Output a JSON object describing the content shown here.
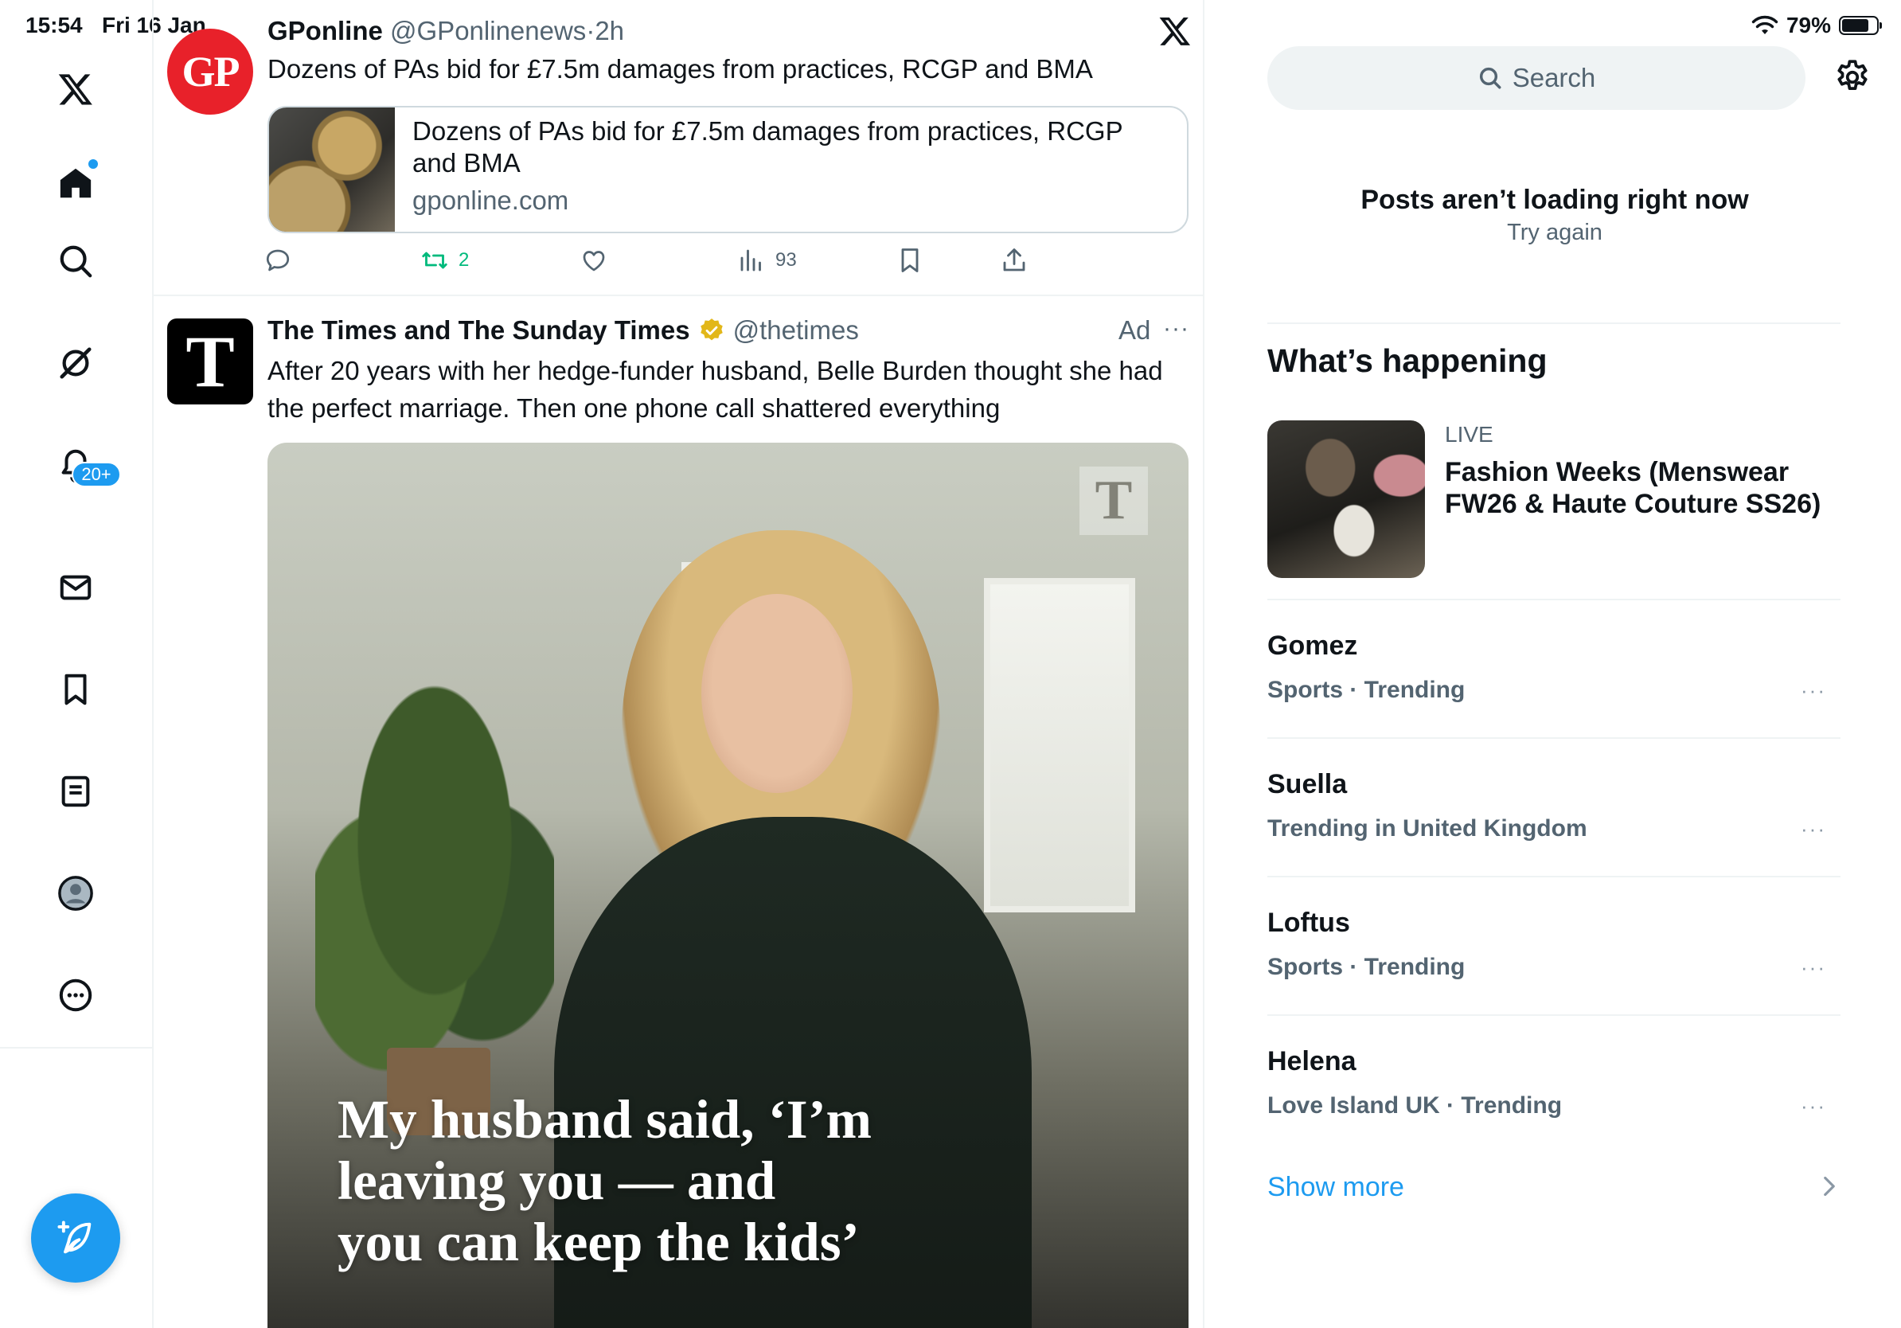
{
  "status_bar": {
    "time": "15:54",
    "date": "Fri 16 Jan",
    "battery": "79%",
    "battery_level": 0.79
  },
  "sidebar": {
    "items": [
      {
        "name": "x-logo"
      },
      {
        "name": "home"
      },
      {
        "name": "explore"
      },
      {
        "name": "grok"
      },
      {
        "name": "notifications",
        "badge": "20+"
      },
      {
        "name": "messages"
      },
      {
        "name": "bookmarks"
      },
      {
        "name": "lists"
      },
      {
        "name": "profile"
      },
      {
        "name": "more"
      }
    ]
  },
  "feed": {
    "tweet1": {
      "avatar_text": "GP",
      "name": "GPonline",
      "handle": "@GPonlinenews",
      "time": "2h",
      "text": "Dozens of PAs bid for £7.5m damages from practices, RCGP and BMA",
      "card": {
        "title": "Dozens of PAs bid for £7.5m damages from practices, RCGP and BMA",
        "domain": "gponline.com"
      },
      "actions": {
        "retweets": "2",
        "views": "93"
      }
    },
    "tweet2": {
      "avatar_text": "T",
      "name": "The Times and The Sunday Times",
      "handle": "@thetimes",
      "ad_label": "Ad",
      "text": "After 20 years with her hedge-funder husband, Belle Burden thought she had the perfect marriage. Then one phone call shattered everything",
      "image_logo": "T",
      "image_headline_lines": [
        "My husband said, ‘I’m",
        "leaving you — and",
        "you can keep the kids’"
      ]
    }
  },
  "right": {
    "search_placeholder": "Search",
    "error": {
      "title": "Posts aren’t loading right now",
      "retry": "Try again"
    },
    "whats_happening": {
      "title": "What’s happening",
      "live": {
        "label": "LIVE",
        "title": "Fashion Weeks (Menswear FW26 & Haute Couture SS26)"
      },
      "trends": [
        {
          "name": "Gomez",
          "meta": "Sports · Trending"
        },
        {
          "name": "Suella",
          "meta": "Trending in United Kingdom"
        },
        {
          "name": "Loftus",
          "meta": "Sports · Trending"
        },
        {
          "name": "Helena",
          "meta": "Love Island UK · Trending"
        }
      ],
      "show_more": "Show more"
    }
  },
  "colors": {
    "accent": "#1d9bf0",
    "retweet": "#00ba7c",
    "gp_brand": "#e8212a",
    "verified_gold": "#e2b719"
  }
}
